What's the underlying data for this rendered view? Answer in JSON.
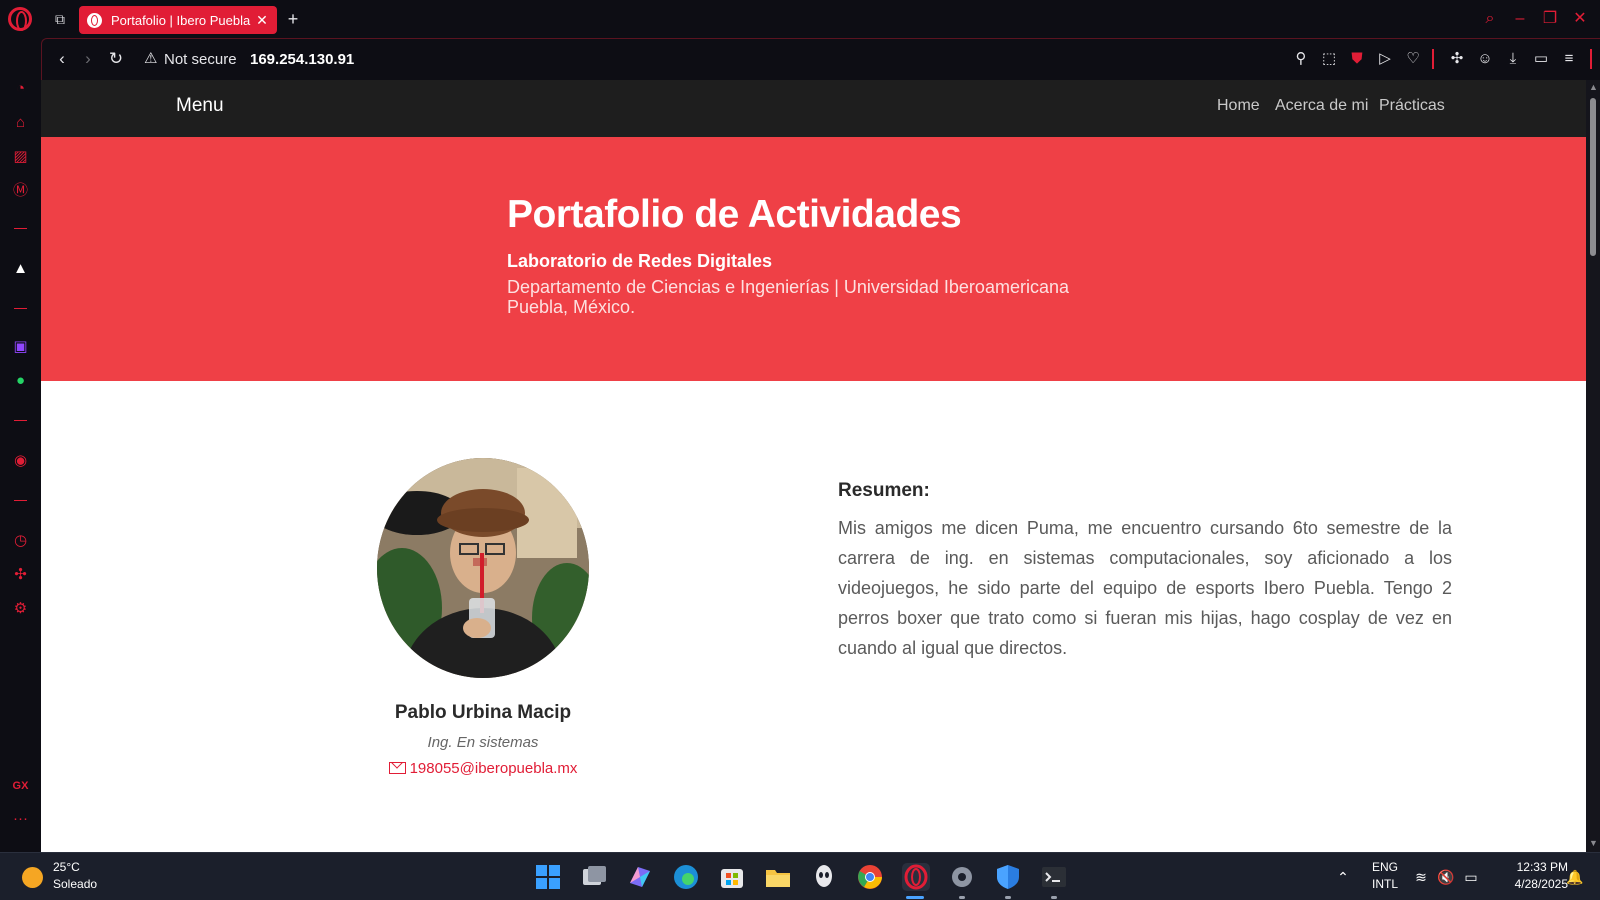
{
  "browser": {
    "tab_title": "Portafolio | Ibero Puebla",
    "tab_close": "✕",
    "new_tab": "+",
    "not_secure": "Not secure",
    "url": "169.254.130.91",
    "accent_color": "#e11d36"
  },
  "site": {
    "brand": "Menu",
    "nav": [
      "Home",
      "Acerca de mi",
      "Prácticas"
    ],
    "hero": {
      "title": "Portafolio de Actividades",
      "subtitle": "Laboratorio de Redes Digitales",
      "line1": "Departamento de Ciencias e Ingenierías | Universidad Iberoamericana",
      "line2": "Puebla, México.",
      "color": "#ef4046"
    },
    "profile": {
      "name": "Pablo Urbina Macip",
      "role": "Ing. En sistemas",
      "email": "198055@iberopuebla.mx"
    },
    "resumen": {
      "title": "Resumen:",
      "text": "Mis amigos me dicen Puma, me encuentro cursando 6to semestre de la carrera de ing. en sistemas computacionales, soy aficionado a los videojuegos, he sido parte del equipo de esports Ibero Puebla. Tengo 2 perros boxer que trato como si fueran mis hijas, hago cosplay de vez en cuando al igual que directos."
    }
  },
  "sidebar": {
    "gx_label": "GX",
    "more_label": "···"
  },
  "taskbar": {
    "weather_temp": "25°C",
    "weather_desc": "Soleado",
    "lang1": "ENG",
    "lang2": "INTL",
    "time": "12:33 PM",
    "date": "4/28/2025"
  }
}
